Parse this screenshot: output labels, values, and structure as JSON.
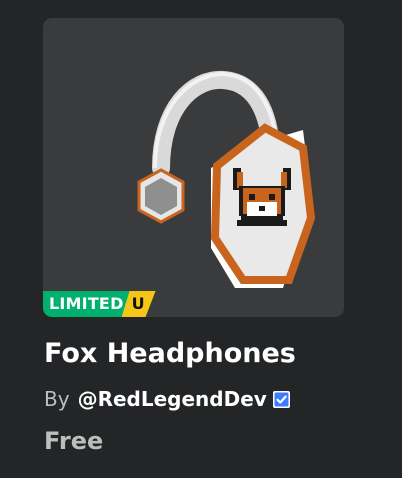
{
  "item": {
    "name": "Fox Headphones",
    "by_label": "By",
    "creator": "@RedLegendDev",
    "price": "Free",
    "badge": {
      "limited": "LIMITED",
      "unique": "U"
    },
    "creator_verified": true
  },
  "icons": {
    "thumbnail": "fox-headphones-image",
    "verified": "verified-badge-icon"
  },
  "colors": {
    "background": "#232527",
    "card": "#393b3d",
    "limited_green": "#00b06f",
    "unique_yellow": "#f5c518",
    "verified_blue": "#3d7bff",
    "fox_orange": "#c8641e"
  }
}
